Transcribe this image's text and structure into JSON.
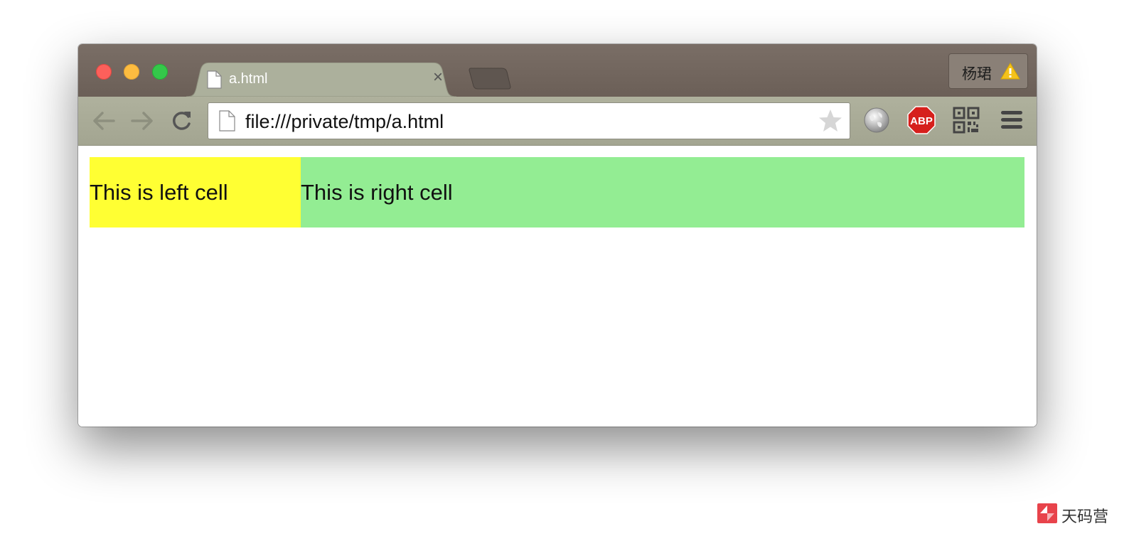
{
  "tab": {
    "title": "a.html",
    "close_label": "×"
  },
  "profile": {
    "name": "杨珺"
  },
  "omnibox": {
    "url": "file:///private/tmp/a.html"
  },
  "extensions": {
    "abp_label": "ABP"
  },
  "content": {
    "left_cell": "This is left cell",
    "right_cell": "This is right cell"
  },
  "colors": {
    "left_cell_bg": "#ffff33",
    "right_cell_bg": "#93ed93"
  },
  "watermark": {
    "text": "天码营"
  },
  "icons": [
    "back-arrow-icon",
    "forward-arrow-icon",
    "reload-icon",
    "page-icon",
    "bookmark-star-icon",
    "globe-icon",
    "adblock-icon",
    "qr-code-icon",
    "menu-icon",
    "warning-icon"
  ]
}
